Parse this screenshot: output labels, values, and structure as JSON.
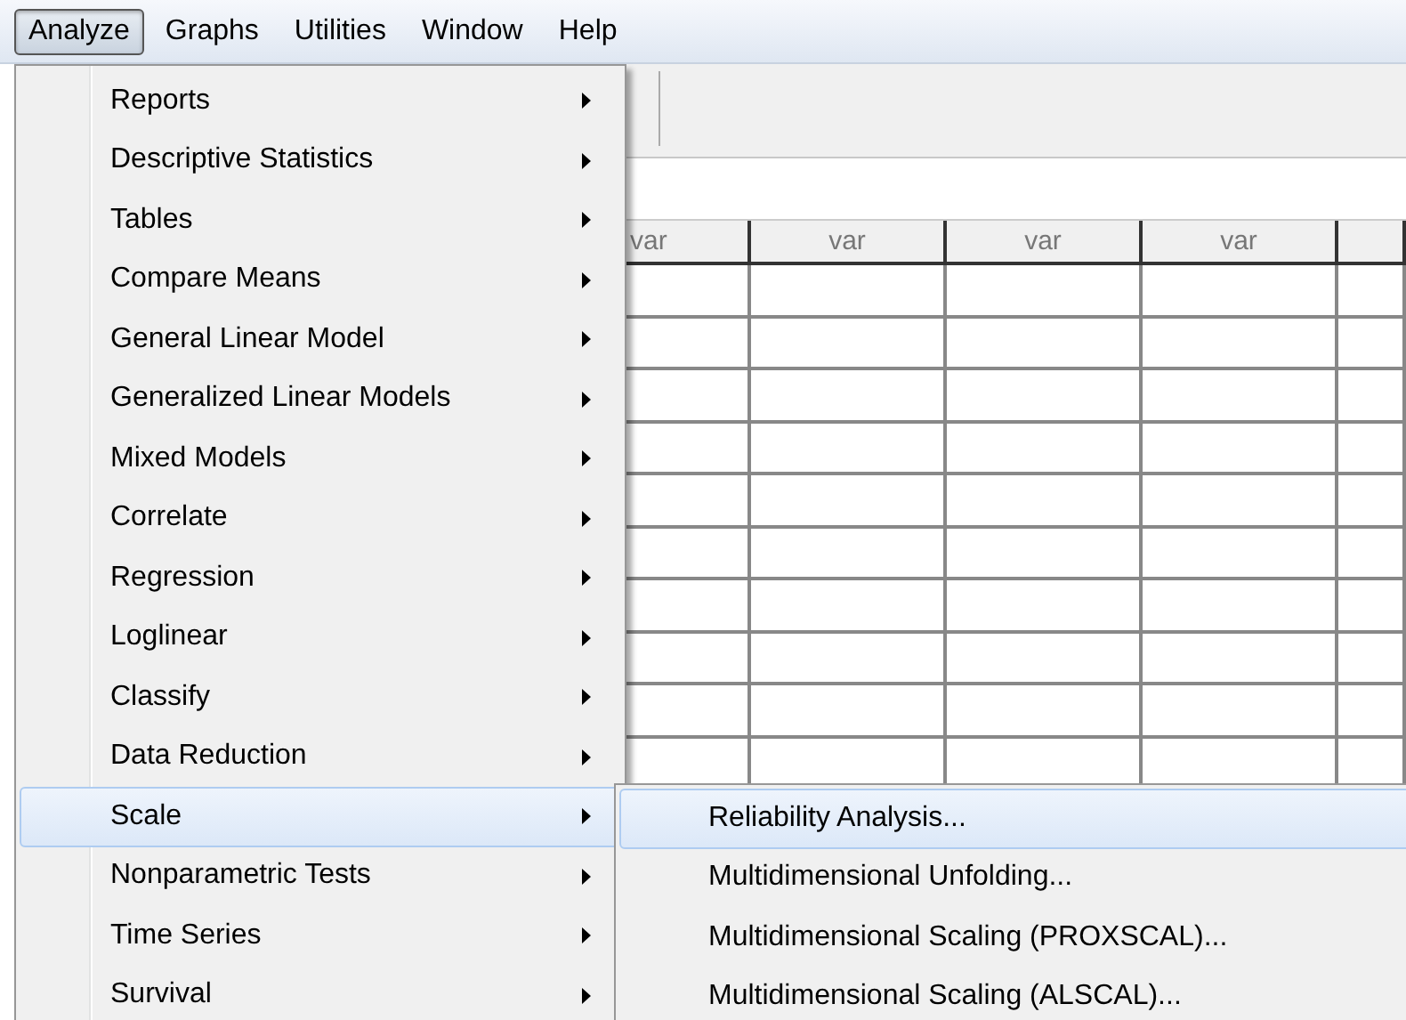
{
  "menubar": [
    {
      "label": "Analyze",
      "selected": true
    },
    {
      "label": "Graphs",
      "selected": false
    },
    {
      "label": "Utilities",
      "selected": false
    },
    {
      "label": "Window",
      "selected": false
    },
    {
      "label": "Help",
      "selected": false
    }
  ],
  "grid": {
    "columns": [
      "var",
      "var",
      "var",
      "var"
    ]
  },
  "analyze_menu": [
    {
      "label": "Reports",
      "selected": false
    },
    {
      "label": "Descriptive Statistics",
      "selected": false
    },
    {
      "label": "Tables",
      "selected": false
    },
    {
      "label": "Compare Means",
      "selected": false
    },
    {
      "label": "General Linear Model",
      "selected": false
    },
    {
      "label": "Generalized Linear Models",
      "selected": false
    },
    {
      "label": "Mixed Models",
      "selected": false
    },
    {
      "label": "Correlate",
      "selected": false
    },
    {
      "label": "Regression",
      "selected": false
    },
    {
      "label": "Loglinear",
      "selected": false
    },
    {
      "label": "Classify",
      "selected": false
    },
    {
      "label": "Data Reduction",
      "selected": false
    },
    {
      "label": "Scale",
      "selected": true
    },
    {
      "label": "Nonparametric Tests",
      "selected": false
    },
    {
      "label": "Time Series",
      "selected": false
    },
    {
      "label": "Survival",
      "selected": false
    }
  ],
  "scale_submenu": [
    {
      "label": "Reliability Analysis...",
      "selected": true
    },
    {
      "label": "Multidimensional Unfolding...",
      "selected": false
    },
    {
      "label": "Multidimensional Scaling (PROXSCAL)...",
      "selected": false
    },
    {
      "label": "Multidimensional Scaling (ALSCAL)...",
      "selected": false
    }
  ]
}
